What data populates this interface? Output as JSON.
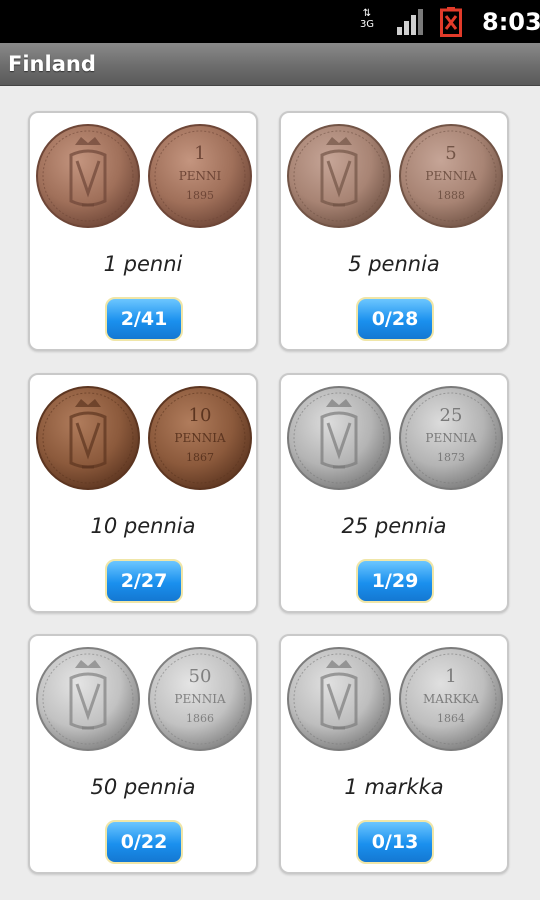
{
  "status_bar": {
    "network_label_top": "⇅",
    "network_label": "3G",
    "clock": "8:03"
  },
  "header": {
    "title": "Finland"
  },
  "coins": [
    {
      "name": "1 penni",
      "count": "2/41",
      "reverse_lines": [
        "1",
        "PENNI",
        "1895"
      ],
      "color_base": "#a0705a",
      "color_dark": "#6e4637",
      "color_light": "#c4957f"
    },
    {
      "name": "5 pennia",
      "count": "0/28",
      "reverse_lines": [
        "5",
        "PENNIA",
        "1888"
      ],
      "color_base": "#a88474",
      "color_dark": "#725446",
      "color_light": "#c6a597"
    },
    {
      "name": "10 pennia",
      "count": "2/27",
      "reverse_lines": [
        "10",
        "PENNIA",
        "1867"
      ],
      "color_base": "#8c5a3c",
      "color_dark": "#5c3520",
      "color_light": "#b07c5c"
    },
    {
      "name": "25 pennia",
      "count": "1/29",
      "reverse_lines": [
        "25",
        "PENNIA",
        "1873"
      ],
      "color_base": "#b4b4b4",
      "color_dark": "#7a7a7a",
      "color_light": "#dcdcdc"
    },
    {
      "name": "50 pennia",
      "count": "0/22",
      "reverse_lines": [
        "50",
        "PENNIA",
        "1866"
      ],
      "color_base": "#c2c2c2",
      "color_dark": "#808080",
      "color_light": "#e4e4e4"
    },
    {
      "name": "1 markka",
      "count": "0/13",
      "reverse_lines": [
        "1",
        "MARKKA",
        "1864"
      ],
      "color_base": "#bebebe",
      "color_dark": "#7c7c7c",
      "color_light": "#e0e0e0"
    }
  ]
}
